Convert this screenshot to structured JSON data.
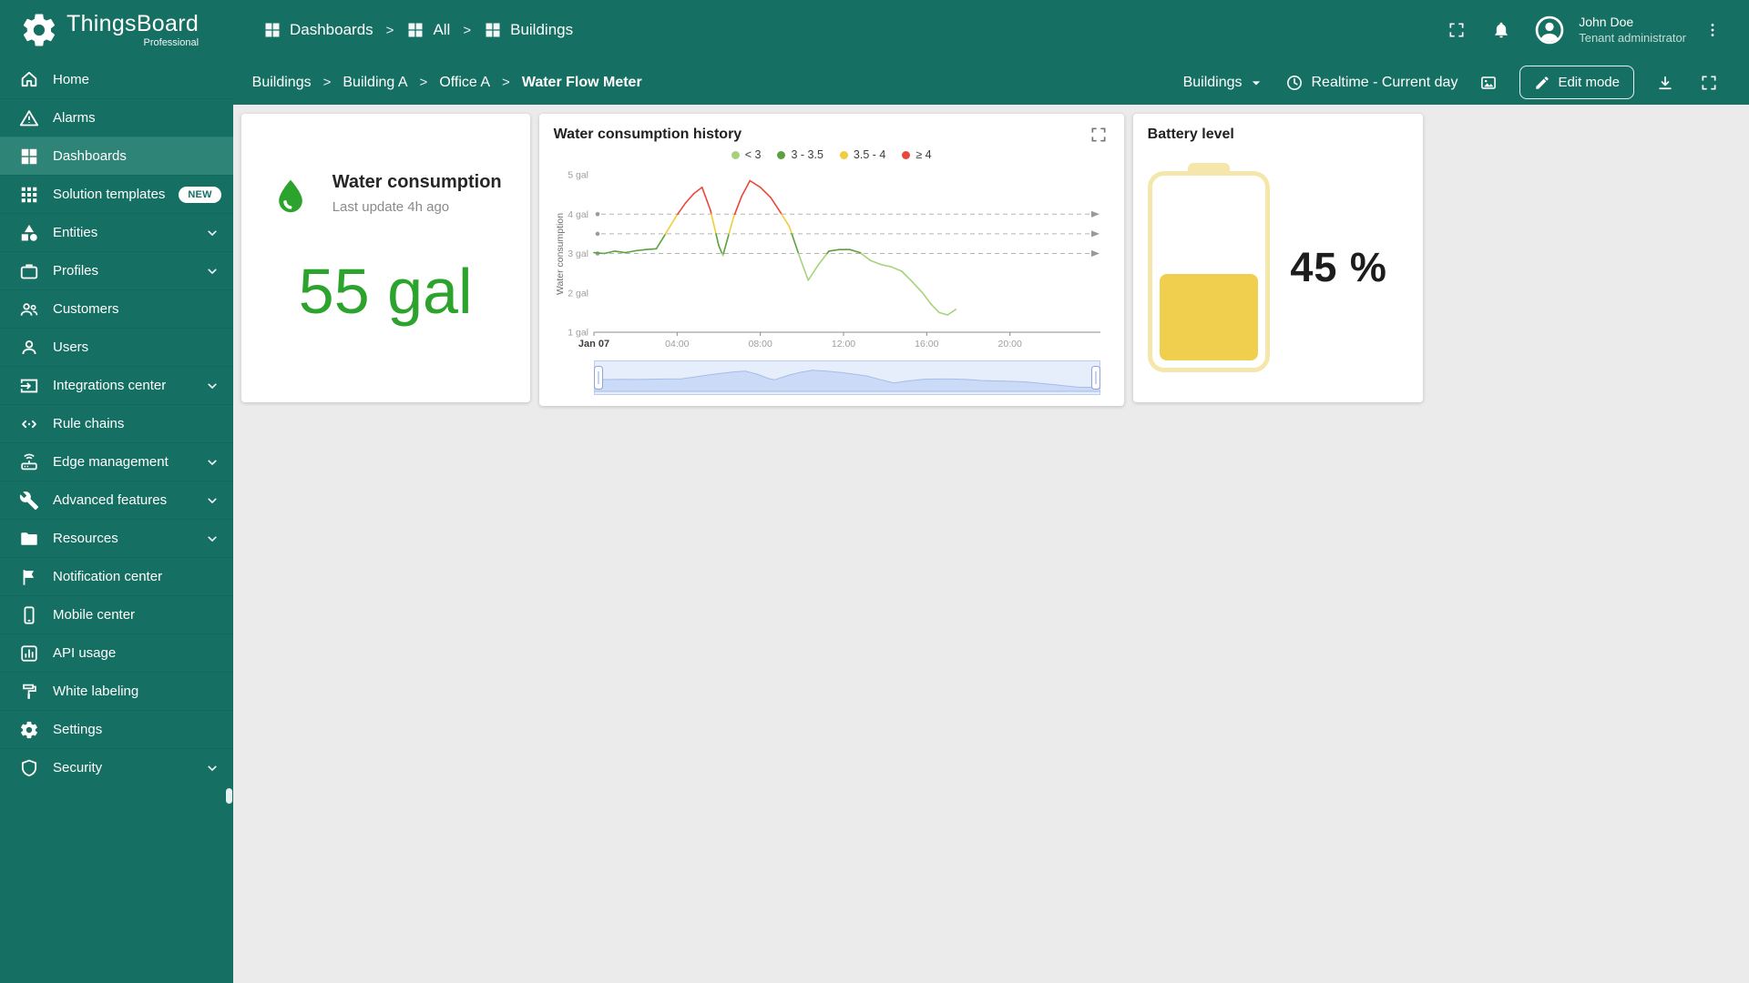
{
  "colors": {
    "primary": "#156F62",
    "primary_light": "#2E8476",
    "accent_green": "#2CA32C",
    "page_bg": "#EBEBEB"
  },
  "brand": {
    "name": "ThingsBoard",
    "edition": "Professional",
    "logo_icon": "gear-logo-icon"
  },
  "header": {
    "breadcrumb": {
      "separator": ">",
      "items": [
        {
          "label": "Dashboards",
          "icon": "dashboard-group-icon"
        },
        {
          "label": "All",
          "icon": "dashboard-group-icon"
        },
        {
          "label": "Buildings",
          "icon": "dashboard-group-icon"
        }
      ]
    },
    "actions": [
      {
        "name": "fullscreen-toggle-button",
        "icon": "fullscreen-icon"
      },
      {
        "name": "notifications-button",
        "icon": "bell-icon"
      }
    ],
    "user": {
      "avatar_icon": "person-circle-icon",
      "name": "John Doe",
      "role": "Tenant administrator",
      "menu_icon": "kebab-icon"
    }
  },
  "toolbar": {
    "breadcrumb": {
      "separator": ">",
      "items": [
        "Buildings",
        "Building A",
        "Office A",
        "Water Flow Meter"
      ]
    },
    "entity_select": {
      "label": "Buildings",
      "caret_icon": "caret-down-icon"
    },
    "timewindow": {
      "clock_icon": "clock-icon",
      "label": "Realtime - Current day"
    },
    "image_action_icon": "image-icon",
    "edit_button": {
      "pencil_icon": "pencil-icon",
      "label": "Edit mode"
    },
    "download_icon": "download-icon",
    "fullscreen_icon": "fullscreen-icon"
  },
  "sidebar": {
    "items": [
      {
        "label": "Home",
        "icon": "home-icon"
      },
      {
        "label": "Alarms",
        "icon": "alarms-icon"
      },
      {
        "label": "Dashboards",
        "icon": "dashboards-icon",
        "selected": true
      },
      {
        "label": "Solution templates",
        "icon": "solution-templates-icon",
        "badge": "NEW"
      },
      {
        "label": "Entities",
        "icon": "entities-icon",
        "expandable": true
      },
      {
        "label": "Profiles",
        "icon": "profiles-icon",
        "expandable": true
      },
      {
        "label": "Customers",
        "icon": "customers-icon"
      },
      {
        "label": "Users",
        "icon": "users-icon"
      },
      {
        "label": "Integrations center",
        "icon": "integrations-icon",
        "expandable": true
      },
      {
        "label": "Rule chains",
        "icon": "rule-chains-icon"
      },
      {
        "label": "Edge management",
        "icon": "edge-icon",
        "expandable": true
      },
      {
        "label": "Advanced features",
        "icon": "advanced-icon",
        "expandable": true
      },
      {
        "label": "Resources",
        "icon": "resources-icon",
        "expandable": true
      },
      {
        "label": "Notification center",
        "icon": "notification-icon"
      },
      {
        "label": "Mobile center",
        "icon": "mobile-icon"
      },
      {
        "label": "API usage",
        "icon": "api-icon"
      },
      {
        "label": "White labeling",
        "icon": "white-labeling-icon"
      },
      {
        "label": "Settings",
        "icon": "settings-icon"
      },
      {
        "label": "Security",
        "icon": "security-icon",
        "expandable": true
      }
    ]
  },
  "cards": {
    "consumption": {
      "icon": "water-drop-icon",
      "title": "Water consumption",
      "subtitle": "Last update 4h ago",
      "value": "55 gal"
    },
    "history": {
      "expand_icon": "expand-icon"
    },
    "battery": {
      "title": "Battery level",
      "percent": 45,
      "label": "45 %",
      "fill_color": "#EFCF4D",
      "shell_color": "#F5E7AC"
    }
  },
  "chart_data": {
    "type": "line",
    "title": "Water consumption history",
    "ylabel": "Water consumption",
    "xlabel": "",
    "ylim": [
      1,
      5
    ],
    "xlim_hours": [
      0,
      24
    ],
    "y_tick_labels": [
      "5 gal",
      "4 gal",
      "3 gal",
      "2 gal",
      "1 gal"
    ],
    "x_ticks": [
      {
        "hour": 0,
        "label": "Jan 07",
        "emphasis": true
      },
      {
        "hour": 4,
        "label": "04:00"
      },
      {
        "hour": 8,
        "label": "08:00"
      },
      {
        "hour": 12,
        "label": "12:00"
      },
      {
        "hour": 16,
        "label": "16:00"
      },
      {
        "hour": 20,
        "label": "20:00"
      }
    ],
    "thresholds": [
      3,
      3.5,
      4
    ],
    "legend": [
      {
        "label": "< 3",
        "color": "#A9D17C"
      },
      {
        "label": "3 - 3.5",
        "color": "#5BA23F"
      },
      {
        "label": "3.5 - 4",
        "color": "#EFCD3B"
      },
      {
        "label": "≥ 4",
        "color": "#E8483C"
      }
    ],
    "band_colors": {
      "lt3": "#A9D17C",
      "b3_35": "#5BA23F",
      "b35_4": "#EFCD3B",
      "ge4": "#E8483C"
    },
    "grid": "off",
    "legend_position": "top",
    "series": [
      {
        "name": "Water consumption",
        "unit": "gal",
        "points_hour_value": [
          [
            0,
            3.02
          ],
          [
            0.5,
            3.0
          ],
          [
            1,
            3.06
          ],
          [
            1.5,
            3.02
          ],
          [
            2,
            3.07
          ],
          [
            2.5,
            3.1
          ],
          [
            3,
            3.12
          ],
          [
            3.5,
            3.55
          ],
          [
            4,
            3.98
          ],
          [
            4.4,
            4.28
          ],
          [
            4.8,
            4.52
          ],
          [
            5.2,
            4.68
          ],
          [
            5.6,
            4.1
          ],
          [
            6,
            3.2
          ],
          [
            6.2,
            2.95
          ],
          [
            6.7,
            3.9
          ],
          [
            7.1,
            4.45
          ],
          [
            7.5,
            4.85
          ],
          [
            8,
            4.68
          ],
          [
            8.5,
            4.42
          ],
          [
            9,
            4.02
          ],
          [
            9.4,
            3.68
          ],
          [
            9.8,
            3.05
          ],
          [
            10.3,
            2.32
          ],
          [
            10.8,
            2.72
          ],
          [
            11.3,
            3.06
          ],
          [
            11.8,
            3.1
          ],
          [
            12.3,
            3.1
          ],
          [
            12.8,
            3.02
          ],
          [
            13.3,
            2.82
          ],
          [
            13.8,
            2.72
          ],
          [
            14.3,
            2.66
          ],
          [
            14.8,
            2.55
          ],
          [
            15.3,
            2.28
          ],
          [
            15.8,
            2.0
          ],
          [
            16.2,
            1.72
          ],
          [
            16.6,
            1.5
          ],
          [
            17,
            1.44
          ],
          [
            17.4,
            1.58
          ]
        ]
      }
    ]
  }
}
